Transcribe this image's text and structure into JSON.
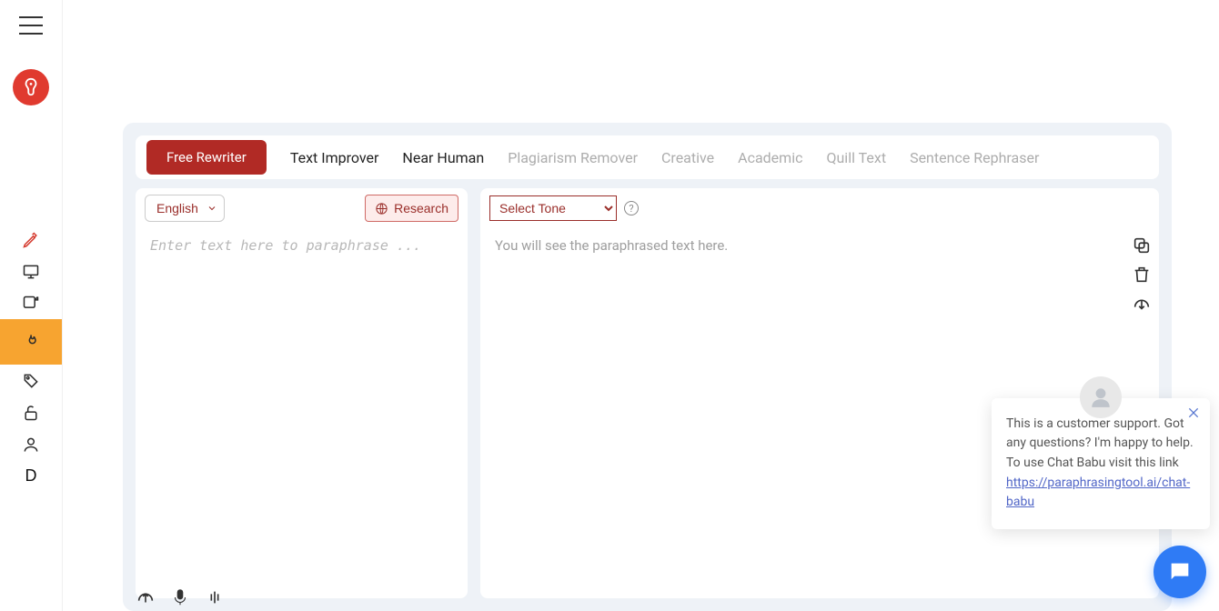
{
  "sidebar": {
    "letter_item": "D"
  },
  "tabs": [
    {
      "label": "Free Rewriter",
      "state": "active"
    },
    {
      "label": "Text Improver",
      "state": "enabled"
    },
    {
      "label": "Near Human",
      "state": "enabled"
    },
    {
      "label": "Plagiarism Remover",
      "state": "disabled"
    },
    {
      "label": "Creative",
      "state": "disabled"
    },
    {
      "label": "Academic",
      "state": "disabled"
    },
    {
      "label": "Quill Text",
      "state": "disabled"
    },
    {
      "label": "Sentence Rephraser",
      "state": "disabled"
    }
  ],
  "left_pane": {
    "language": "English",
    "research_label": "Research",
    "input_placeholder": "Enter text here to paraphrase ..."
  },
  "right_pane": {
    "tone_placeholder": "Select Tone",
    "output_placeholder": "You will see the paraphrased text here."
  },
  "chat": {
    "message": "This is a customer support. Got any questions? I'm happy to help. To use Chat Babu visit this link",
    "link_text": "https://paraphrasingtool.ai/chat-babu"
  },
  "colors": {
    "accent_red": "#b12a25",
    "accent_orange": "#f7a430",
    "chat_blue": "#2f7bf5"
  }
}
